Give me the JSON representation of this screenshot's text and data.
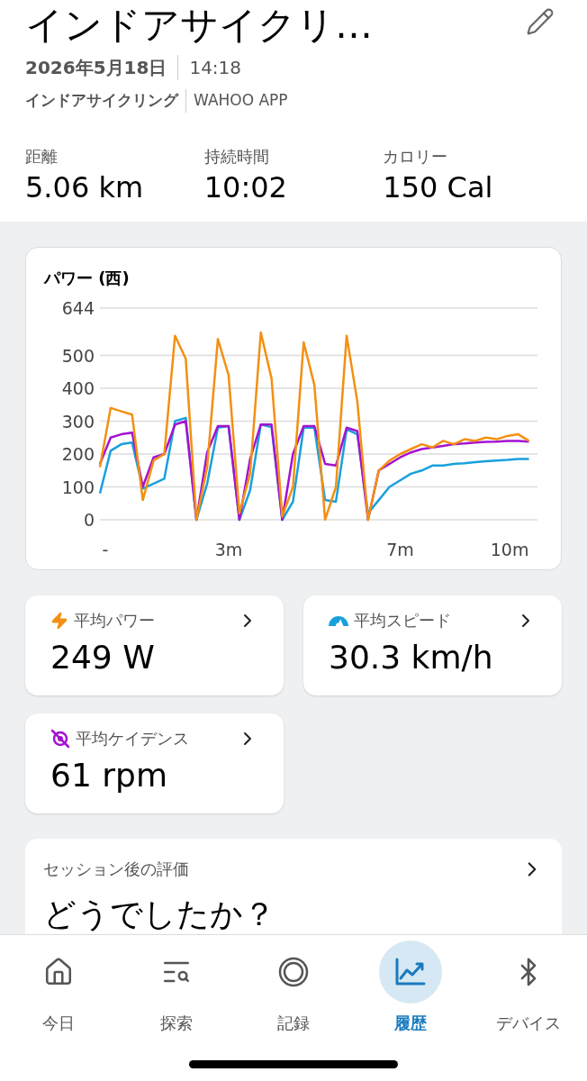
{
  "header": {
    "title": "インドアサイクリ…",
    "date": "2026年5月18日",
    "time": "14:18",
    "activity": "インドアサイクリング",
    "source": "WAHOO APP"
  },
  "stats": [
    {
      "label": "距離",
      "value": "5.06 km"
    },
    {
      "label": "持続時間",
      "value": "10:02"
    },
    {
      "label": "カロリー",
      "value": "150 Cal"
    }
  ],
  "power_chart": {
    "title": "パワー (西)",
    "chart_data": {
      "type": "line",
      "grid": true,
      "xlim": [
        0,
        10.2
      ],
      "ylim": [
        0,
        644
      ],
      "yticks": [
        0,
        100,
        200,
        300,
        400,
        500,
        644
      ],
      "xticks": [
        {
          "value": 0,
          "label": "-"
        },
        {
          "value": 3,
          "label": "3m"
        },
        {
          "value": 7,
          "label": "7m"
        },
        {
          "value": 10,
          "label": "10m"
        }
      ],
      "x": [
        0,
        0.25,
        0.5,
        0.75,
        1,
        1.25,
        1.5,
        1.75,
        2,
        2.25,
        2.5,
        2.75,
        3,
        3.25,
        3.5,
        3.75,
        4,
        4.25,
        4.5,
        4.75,
        5,
        5.25,
        5.5,
        5.75,
        6,
        6.25,
        6.5,
        6.75,
        7,
        7.25,
        7.5,
        7.75,
        8,
        8.25,
        8.5,
        8.75,
        9,
        9.25,
        9.5,
        9.75,
        10
      ],
      "series": [
        {
          "color": "#19a0dc",
          "values": [
            80,
            210,
            230,
            235,
            95,
            110,
            125,
            300,
            310,
            0,
            110,
            280,
            285,
            0,
            90,
            290,
            282,
            0,
            55,
            280,
            280,
            60,
            55,
            275,
            260,
            20,
            60,
            100,
            120,
            140,
            150,
            165,
            165,
            170,
            172,
            175,
            178,
            180,
            182,
            185,
            185
          ]
        },
        {
          "color": "#a412d0",
          "values": [
            170,
            250,
            260,
            265,
            100,
            190,
            200,
            290,
            300,
            0,
            205,
            285,
            285,
            0,
            185,
            290,
            290,
            0,
            200,
            285,
            285,
            170,
            165,
            280,
            270,
            0,
            150,
            170,
            190,
            205,
            215,
            220,
            225,
            230,
            232,
            235,
            237,
            238,
            240,
            240,
            238
          ]
        },
        {
          "color": "#f39012",
          "values": [
            160,
            340,
            330,
            320,
            60,
            180,
            200,
            560,
            490,
            0,
            160,
            550,
            440,
            20,
            140,
            570,
            430,
            10,
            100,
            540,
            410,
            0,
            100,
            560,
            360,
            0,
            150,
            180,
            200,
            215,
            230,
            220,
            240,
            230,
            245,
            240,
            250,
            245,
            255,
            260,
            240
          ]
        }
      ]
    }
  },
  "metrics": [
    {
      "kind": "power",
      "label": "平均パワー",
      "value": "249 W",
      "color": "#f39012"
    },
    {
      "kind": "speed",
      "label": "平均スピード",
      "value": "30.3 km/h",
      "color": "#19a0dc"
    },
    {
      "kind": "cadence",
      "label": "平均ケイデンス",
      "value": "61 rpm",
      "color": "#a412d0"
    }
  ],
  "rating_card": {
    "title": "セッション後の評価",
    "question": "どうでしたか？"
  },
  "nav": [
    {
      "kind": "today",
      "label": "今日",
      "selected": false
    },
    {
      "kind": "explore",
      "label": "探索",
      "selected": false
    },
    {
      "kind": "record",
      "label": "記録",
      "selected": false
    },
    {
      "kind": "history",
      "label": "履歴",
      "selected": true
    },
    {
      "kind": "devices",
      "label": "デバイス",
      "selected": false
    }
  ]
}
